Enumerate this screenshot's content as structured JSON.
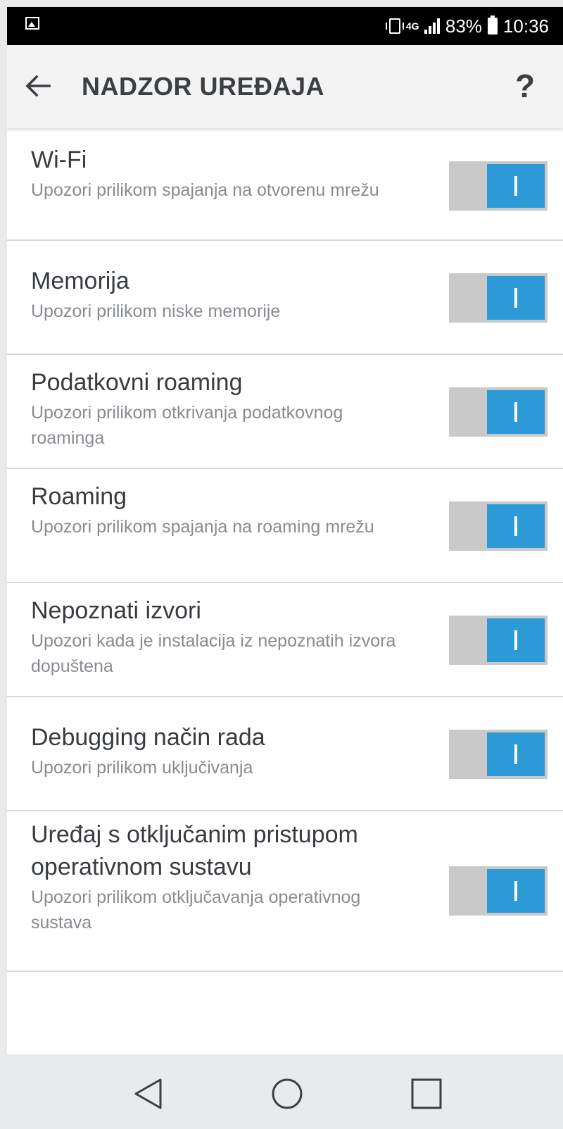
{
  "status_bar": {
    "network_type": "4G",
    "battery": "83%",
    "time": "10:36"
  },
  "header": {
    "title": "NADZOR UREĐAJA",
    "help_label": "?"
  },
  "settings": [
    {
      "title": "Wi-Fi",
      "subtitle": "Upozori prilikom spajanja na otvorenu mrežu",
      "enabled": true
    },
    {
      "title": "Memorija",
      "subtitle": "Upozori prilikom niske memorije",
      "enabled": true
    },
    {
      "title": "Podatkovni roaming",
      "subtitle": "Upozori prilikom otkrivanja podatkovnog roaminga",
      "enabled": true
    },
    {
      "title": "Roaming",
      "subtitle": "Upozori prilikom spajanja na roaming mrežu",
      "enabled": true
    },
    {
      "title": "Nepoznati izvori",
      "subtitle": "Upozori kada je instalacija iz nepoznatih izvora dopuštena",
      "enabled": true
    },
    {
      "title": "Debugging način rada",
      "subtitle": "Upozori prilikom uključivanja",
      "enabled": true
    },
    {
      "title": "Uređaj s otključanim pristupom operativnom sustavu",
      "subtitle": "Upozori prilikom otključavanja operativnog sustava",
      "enabled": true
    }
  ],
  "colors": {
    "toggle_on": "#2b9ad6",
    "toggle_track": "#c9c9c9",
    "title_text": "#383c40",
    "subtitle_text": "#888c91"
  },
  "icons": {
    "back": "arrow-back-icon",
    "nav_back": "triangle-back-icon",
    "nav_home": "circle-home-icon",
    "nav_recents": "square-recents-icon"
  }
}
